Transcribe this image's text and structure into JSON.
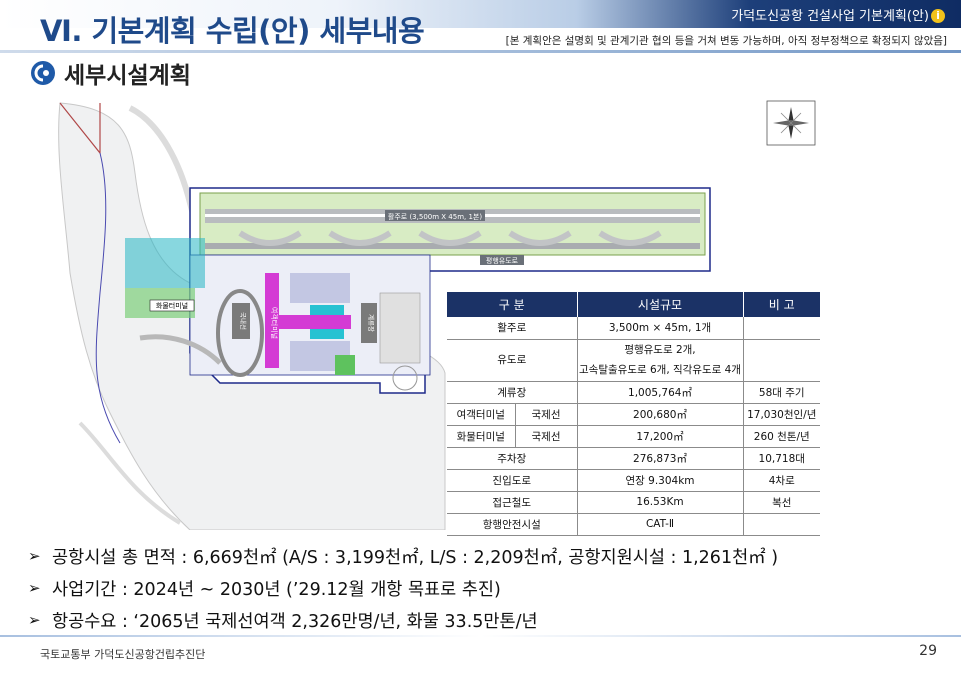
{
  "header": {
    "title": "Ⅵ. 기본계획 수립(안) 세부내용",
    "right_label": "가덕도신공항 건설사업 기본계획(안)",
    "info_glyph": "i",
    "note": "[본 계획안은 설명회 및 관계기관 협의 등을 거쳐 변동 가능하며, 아직 정부정책으로 확정되지 않았음]"
  },
  "section": {
    "subtitle": "세부시설계획",
    "icon": "section-bullet-icon"
  },
  "map": {
    "runway_label": "활주로 (3,500m X 45m, 1본)",
    "taxiway_label": "평행유도로",
    "cargo_label": "화물터미널",
    "terminal_label_1": "국내선",
    "terminal_label_2": "여객터미널",
    "terminal_label_3": "계류장",
    "compass": "compass-rose-icon"
  },
  "table": {
    "headers": [
      "구 분",
      "시설규모",
      "비 고"
    ],
    "rows": [
      {
        "label": "활주로",
        "scale": "3,500m × 45m, 1개",
        "note": ""
      },
      {
        "label": "유도로",
        "scale_line1": "평행유도로 2개,",
        "scale_line2": "고속탈출유도로 6개, 직각유도로 4개",
        "note": ""
      },
      {
        "label": "계류장",
        "scale": "1,005,764㎡",
        "note": "58대 주기"
      },
      {
        "label": "여객터미널",
        "sub": "국제선",
        "scale": "200,680㎡",
        "note": "17,030천인/년"
      },
      {
        "label": "화물터미널",
        "sub": "국제선",
        "scale": "17,200㎡",
        "note": "260 천톤/년"
      },
      {
        "label": "주차장",
        "scale": "276,873㎡",
        "note": "10,718대"
      },
      {
        "label": "진입도로",
        "scale": "연장 9.304km",
        "note": "4차로"
      },
      {
        "label": "접근철도",
        "scale": "16.53Km",
        "note": "복선"
      },
      {
        "label": "항행안전시설",
        "scale": "CAT-Ⅱ",
        "note": ""
      }
    ]
  },
  "bullets": [
    "공항시설 총 면적 : 6,669천㎡ (A/S : 3,199천㎡, L/S : 2,209천㎡, 공항지원시설 : 1,261천㎡ )",
    "사업기간 : 2024년 ~ 2030년 (’29.12월 개항 목표로 추진)",
    "항공수요 : ‘2065년 국제선여객 2,326만명/년, 화물 33.5만톤/년"
  ],
  "bullet_mark": "➢",
  "footer": {
    "org": "국토교통부 가덕도신공항건립추진단",
    "page": "29"
  },
  "colors": {
    "title": "#1f4a8a",
    "table_header": "#1b3266",
    "runway_zone": "#d8ecc4",
    "apron": "#c3c7e3"
  }
}
